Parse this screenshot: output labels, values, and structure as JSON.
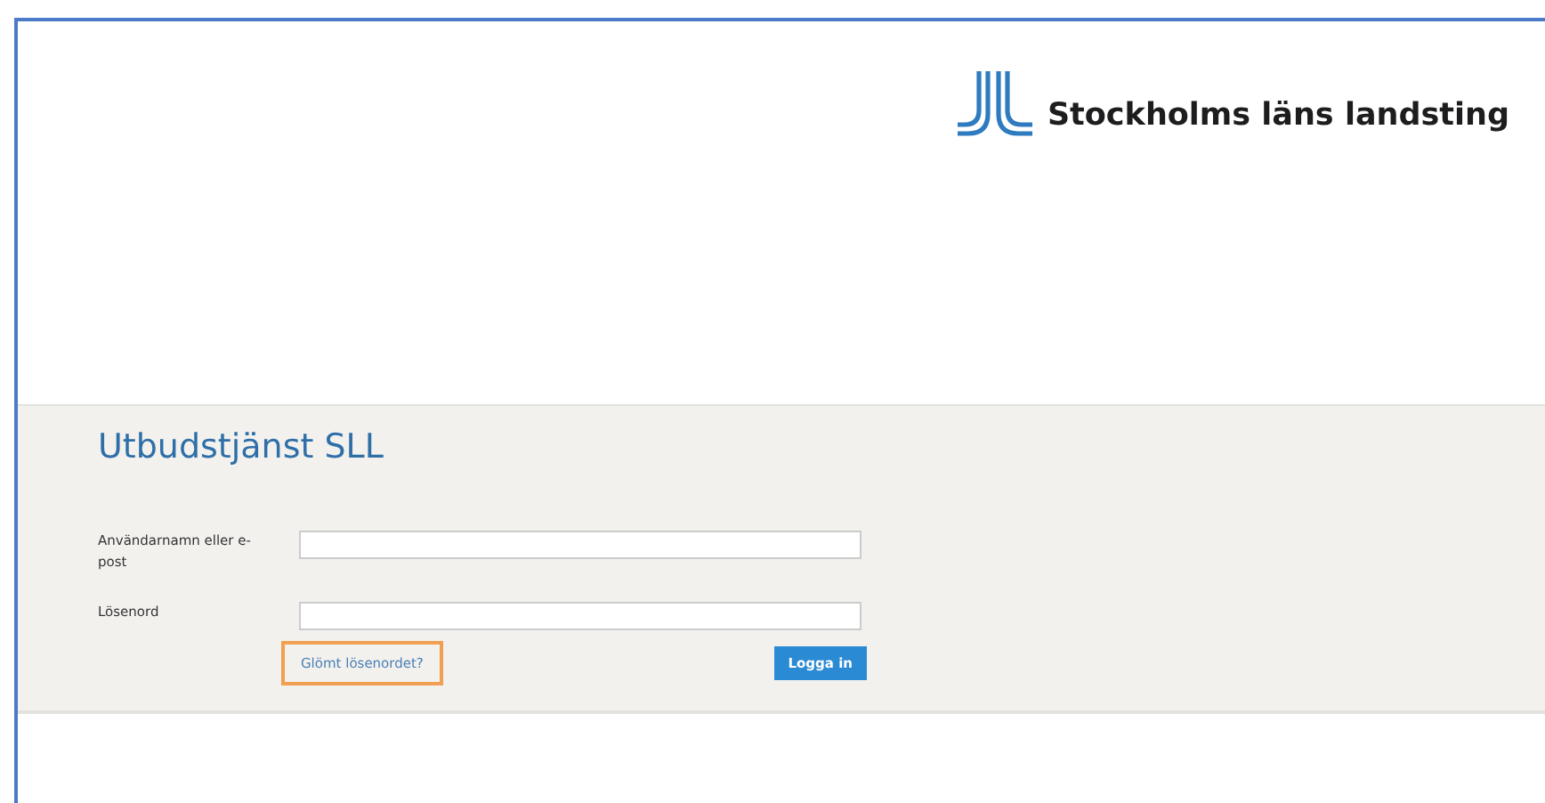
{
  "header": {
    "logo_text": "Stockholms läns landsting"
  },
  "login": {
    "title": "Utbudstjänst SLL",
    "fields": [
      {
        "label": "Användarnamn eller e-post"
      },
      {
        "label": "Lösenord"
      }
    ],
    "forgot_link": {
      "label": "Glömt lösenordet?",
      "focused": true
    },
    "submit": "Logga in"
  }
}
